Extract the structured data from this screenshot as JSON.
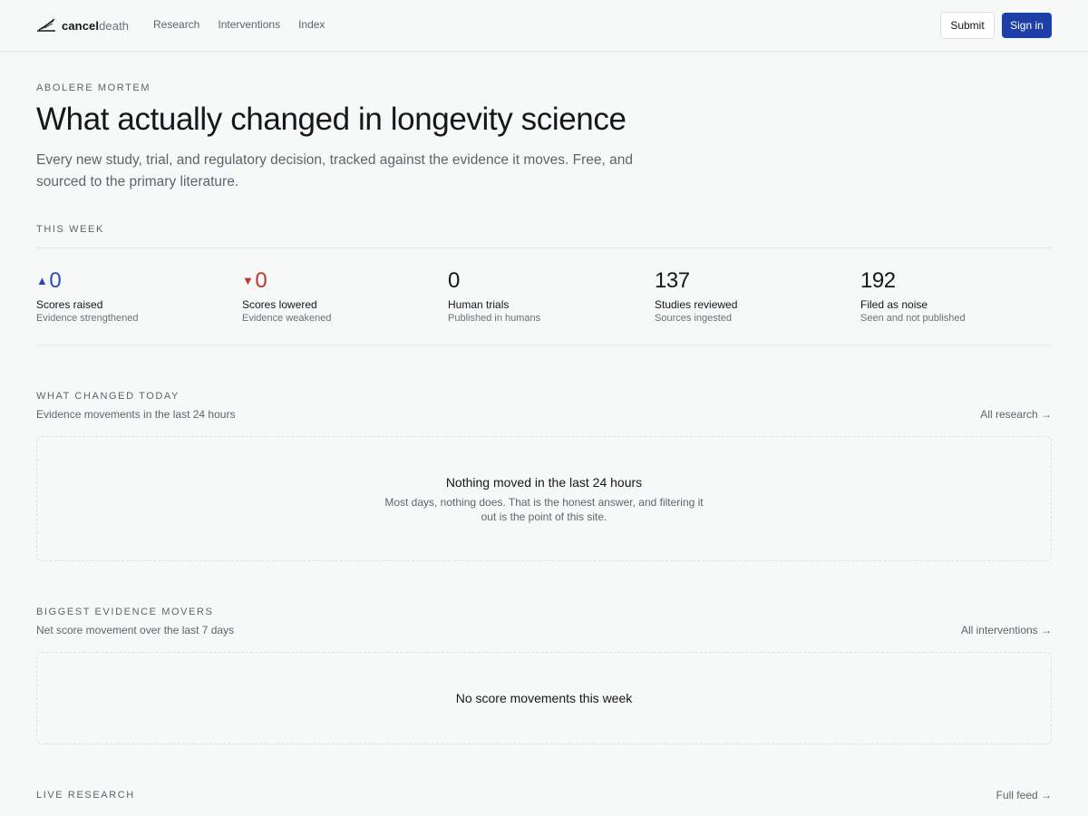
{
  "header": {
    "logo_strong": "cancel",
    "logo_light": "death",
    "nav": [
      "Research",
      "Interventions",
      "Index"
    ],
    "submit_label": "Submit",
    "signin_label": "Sign in"
  },
  "hero": {
    "eyebrow": "ABOLERE MORTEM",
    "title": "What actually changed in longevity science",
    "subtitle": "Every new study, trial, and regulatory decision, tracked against the evidence it moves. Free, and sourced to the primary literature."
  },
  "this_week": {
    "label": "THIS WEEK",
    "stats": [
      {
        "value": "0",
        "label": "Scores raised",
        "desc": "Evidence strengthened",
        "direction": "up"
      },
      {
        "value": "0",
        "label": "Scores lowered",
        "desc": "Evidence weakened",
        "direction": "down"
      },
      {
        "value": "0",
        "label": "Human trials",
        "desc": "Published in humans",
        "direction": "none"
      },
      {
        "value": "137",
        "label": "Studies reviewed",
        "desc": "Sources ingested",
        "direction": "none"
      },
      {
        "value": "192",
        "label": "Filed as noise",
        "desc": "Seen and not published",
        "direction": "none"
      }
    ]
  },
  "changed_today": {
    "label": "WHAT CHANGED TODAY",
    "subtitle": "Evidence movements in the last 24 hours",
    "link": "All research →",
    "empty_title": "Nothing moved in the last 24 hours",
    "empty_desc": "Most days, nothing does. That is the honest answer, and filtering it out is the point of this site."
  },
  "movers": {
    "label": "BIGGEST EVIDENCE MOVERS",
    "subtitle": "Net score movement over the last 7 days",
    "link": "All interventions →",
    "empty_title": "No score movements this week"
  },
  "live": {
    "label": "LIVE RESEARCH",
    "link": "Full feed →"
  },
  "colors": {
    "accent": "#1f3fa8",
    "up": "#2a4bb5",
    "down": "#c8322d"
  }
}
